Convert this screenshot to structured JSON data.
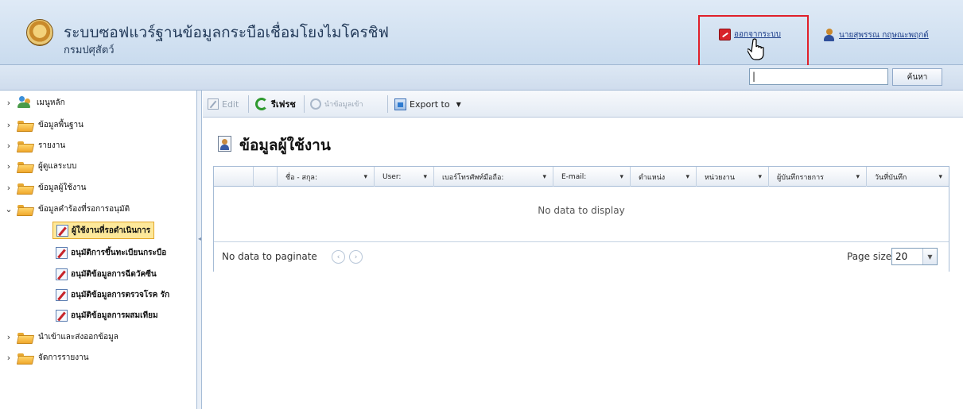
{
  "app": {
    "title": "ระบบซอฟแวร์ฐานข้อมูลกระบือเชื่อมโยงไมโครชิฟ",
    "subtitle": "กรมปศุสัตว์"
  },
  "header": {
    "logout_label": "ออกจากระบบ",
    "user_name": "นายสุพรรณ กฤษณะพฤกต์"
  },
  "search": {
    "value": "|",
    "button_label": "ค้นหา"
  },
  "sidebar": {
    "items": [
      {
        "label": "เมนูหลัก"
      },
      {
        "label": "ข้อมูลพื้นฐาน"
      },
      {
        "label": "รายงาน"
      },
      {
        "label": "ผู้ดูแลระบบ"
      },
      {
        "label": "ข้อมูลผู้ใช้งาน"
      },
      {
        "label": "ข้อมูลคำร้องที่รอการอนุมัติ"
      },
      {
        "label": "นำเข้าและส่งออกข้อมูล"
      },
      {
        "label": "จัดการรายงาน"
      }
    ],
    "children": [
      {
        "label": "ผู้ใช้งานที่รอดำเนินการ"
      },
      {
        "label": "อนุมัติการขึ้นทะเบียนกระบือ"
      },
      {
        "label": "อนุมัติข้อมูลการฉีดวัคซีน"
      },
      {
        "label": "อนุมัติข้อมูลการตรวจโรค รัก"
      },
      {
        "label": "อนุมัติข้อมูลการผสมเทียม"
      }
    ]
  },
  "toolbar": {
    "edit_label": "Edit",
    "refresh_label": "รีเฟรช",
    "import_label": "นำข้อมูลเข้า",
    "export_label": "Export to"
  },
  "page": {
    "title": "ข้อมูลผู้ใช้งาน"
  },
  "grid": {
    "columns": [
      "ชื่อ - สกุล:",
      "User:",
      "เบอร์โทรศัพท์มือถือ:",
      "E-mail:",
      "ตำแหน่ง",
      "หน่วยงาน",
      "ผู้บันทึกรายการ",
      "วันที่บันทึก"
    ],
    "empty_text": "No data to display",
    "pager_text": "No data to paginate",
    "page_size_label": "Page size:",
    "page_size": "20"
  },
  "colors": {
    "highlight_border": "#e0202a",
    "header_bg": "#c9dbee",
    "selected_bg": "#fde89a"
  }
}
